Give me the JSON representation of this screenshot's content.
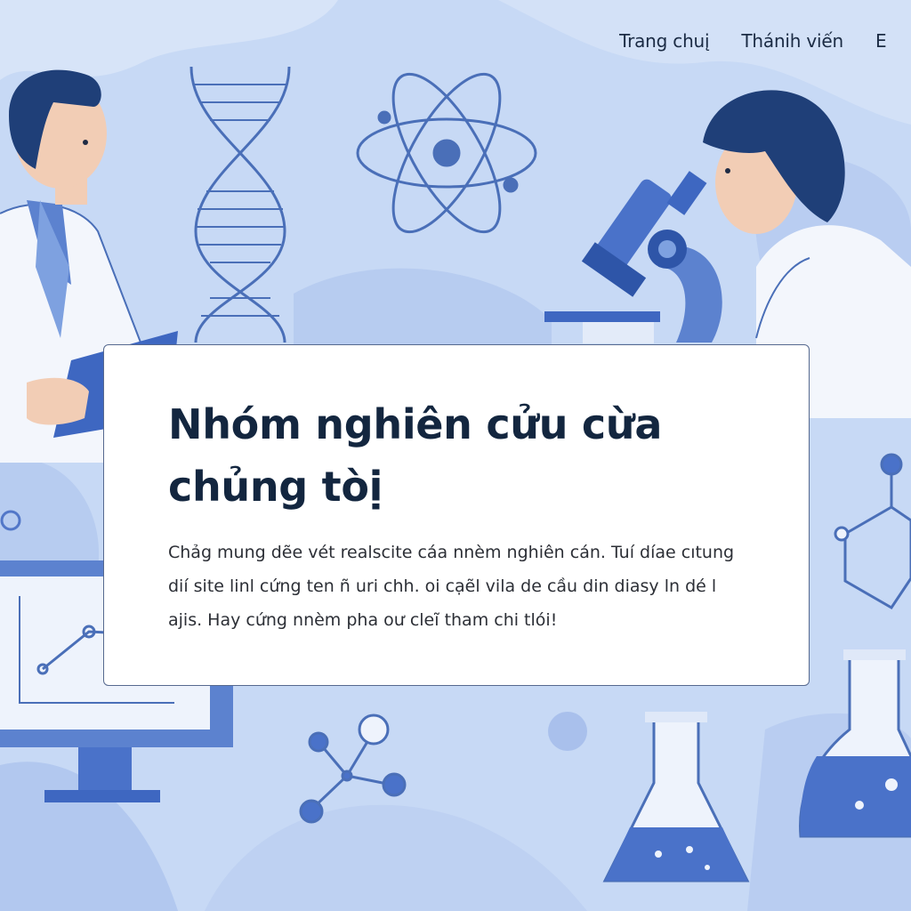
{
  "nav": {
    "items": [
      "Trang chuį",
      "Thánih viến",
      "E"
    ]
  },
  "hero": {
    "title": "Nhóm nghiên cửu cừa chủng tòị",
    "description": "Chảg mung dẽe vét realscite cáa nnèm nghiên cán. Tuí díae cıtung dií site linl cứng ten ñ uri chh. oi cạẽl vila de cầu din diasy ln dé l ajis. Hay cứng nnèm pha oư cleĩ tham chi tlói!"
  },
  "colors": {
    "background": "#c7d9f5",
    "accent": "#4a72c9",
    "card": "#ffffff",
    "title_text": "#13263f"
  },
  "icons": [
    "dna-icon",
    "atom-icon",
    "microscope-icon",
    "molecule-icon",
    "flask-icon",
    "monitor-chart-icon"
  ]
}
